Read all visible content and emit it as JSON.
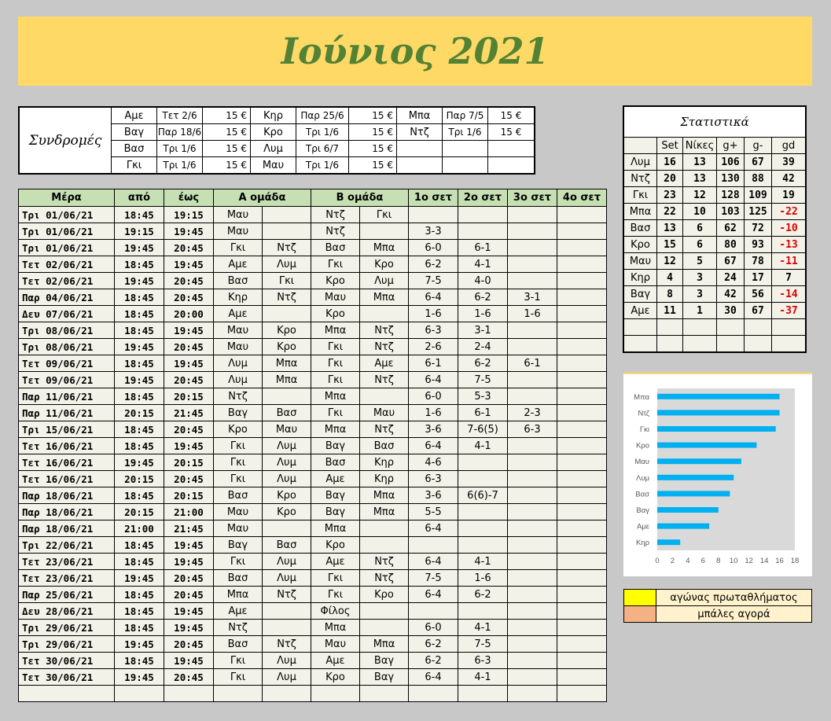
{
  "title": "Ιούνιος 2021",
  "subscriptions": {
    "label": "Συνδρομές",
    "rows": [
      [
        "Αμε",
        "Τετ 2/6",
        "15 €",
        "Κηρ",
        "Παρ 25/6",
        "15 €",
        "Μπα",
        "Παρ 7/5",
        "15 €"
      ],
      [
        "Βαγ",
        "Παρ 18/6",
        "15 €",
        "Κρο",
        "Τρι 1/6",
        "15 €",
        "Ντζ",
        "Τρι 1/6",
        "15 €"
      ],
      [
        "Βασ",
        "Τρι 1/6",
        "15 €",
        "Λυμ",
        "Τρι 6/7",
        "15 €",
        "",
        "",
        ""
      ],
      [
        "Γκι",
        "Τρι 1/6",
        "15 €",
        "Μαυ",
        "Τρι 1/6",
        "15 €",
        "",
        "",
        ""
      ]
    ]
  },
  "schedule": {
    "headers": [
      "Μέρα",
      "από",
      "έως",
      "Α ομάδα",
      "Β ομάδα",
      "1ο σετ",
      "2ο σετ",
      "3ο σετ",
      "4ο σετ"
    ],
    "rows": [
      [
        "Τρι  01/06/21",
        "18:45",
        "19:15",
        "Μαυ",
        "",
        "Ντζ",
        "Γκι",
        "",
        "",
        "",
        ""
      ],
      [
        "Τρι  01/06/21",
        "19:15",
        "19:45",
        "Μαυ",
        "",
        "Ντζ",
        "",
        "3-3",
        "",
        "",
        ""
      ],
      [
        "Τρι  01/06/21",
        "19:45",
        "20:45",
        "Γκι",
        "Ντζ",
        "Βασ",
        "Μπα",
        "6-0",
        "6-1",
        "",
        ""
      ],
      [
        "Τετ  02/06/21",
        "18:45",
        "19:45",
        "Αμε",
        "Λυμ",
        "Γκι",
        "Κρο",
        "6-2",
        "4-1",
        "",
        ""
      ],
      [
        "Τετ  02/06/21",
        "19:45",
        "20:45",
        "Βασ",
        "Γκι",
        "Κρο",
        "Λυμ",
        "7-5",
        "4-0",
        "",
        ""
      ],
      [
        "Παρ  04/06/21",
        "18:45",
        "20:45",
        "Κηρ",
        "Ντζ",
        "Μαυ",
        "Μπα",
        "6-4",
        "6-2",
        "3-1",
        ""
      ],
      [
        "Δευ  07/06/21",
        "18:45",
        "20:00",
        "Αμε",
        "",
        "Κρο",
        "",
        "1-6",
        "1-6",
        "1-6",
        ""
      ],
      [
        "Τρι  08/06/21",
        "18:45",
        "19:45",
        "Μαυ",
        "Κρο",
        "Μπα",
        "Ντζ",
        "6-3",
        "3-1",
        "",
        ""
      ],
      [
        "Τρι  08/06/21",
        "19:45",
        "20:45",
        "Μαυ",
        "Κρο",
        "Γκι",
        "Ντζ",
        "2-6",
        "2-4",
        "",
        ""
      ],
      [
        "Τετ  09/06/21",
        "18:45",
        "19:45",
        "Λυμ",
        "Μπα",
        "Γκι",
        "Αμε",
        "6-1",
        "6-2",
        "6-1",
        ""
      ],
      [
        "Τετ  09/06/21",
        "19:45",
        "20:45",
        "Λυμ",
        "Μπα",
        "Γκι",
        "Ντζ",
        "6-4",
        "7-5",
        "",
        ""
      ],
      [
        "Παρ  11/06/21",
        "18:45",
        "20:15",
        "Ντζ",
        "",
        "Μπα",
        "",
        "6-0",
        "5-3",
        "",
        ""
      ],
      [
        "Παρ  11/06/21",
        "20:15",
        "21:45",
        "Βαγ",
        "Βασ",
        "Γκι",
        "Μαυ",
        "1-6",
        "6-1",
        "2-3",
        ""
      ],
      [
        "Τρι  15/06/21",
        "18:45",
        "20:45",
        "Κρο",
        "Μαυ",
        "Μπα",
        "Ντζ",
        "3-6",
        "7-6(5)",
        "6-3",
        ""
      ],
      [
        "Τετ  16/06/21",
        "18:45",
        "19:45",
        "Γκι",
        "Λυμ",
        "Βαγ",
        "Βασ",
        "6-4",
        "4-1",
        "",
        ""
      ],
      [
        "Τετ  16/06/21",
        "19:45",
        "20:15",
        "Γκι",
        "Λυμ",
        "Βασ",
        "Κηρ",
        "4-6",
        "",
        "",
        ""
      ],
      [
        "Τετ  16/06/21",
        "20:15",
        "20:45",
        "Γκι",
        "Λυμ",
        "Αμε",
        "Κηρ",
        "6-3",
        "",
        "",
        ""
      ],
      [
        "Παρ  18/06/21",
        "18:45",
        "20:15",
        "Βασ",
        "Κρο",
        "Βαγ",
        "Μπα",
        "3-6",
        "6(6)-7",
        "",
        ""
      ],
      [
        "Παρ  18/06/21",
        "20:15",
        "21:00",
        "Μαυ",
        "Κρο",
        "Βαγ",
        "Μπα",
        "5-5",
        "",
        "",
        ""
      ],
      [
        "Παρ  18/06/21",
        "21:00",
        "21:45",
        "Μαυ",
        "",
        "Μπα",
        "",
        "6-4",
        "",
        "",
        ""
      ],
      [
        "Τρι  22/06/21",
        "18:45",
        "19:45",
        "Βαγ",
        "Βασ",
        "Κρο",
        "",
        "",
        "",
        "",
        ""
      ],
      [
        "Τετ  23/06/21",
        "18:45",
        "19:45",
        "Γκι",
        "Λυμ",
        "Αμε",
        "Ντζ",
        "6-4",
        "4-1",
        "",
        ""
      ],
      [
        "Τετ  23/06/21",
        "19:45",
        "20:45",
        "Βασ",
        "Λυμ",
        "Γκι",
        "Ντζ",
        "7-5",
        "1-6",
        "",
        ""
      ],
      [
        "Παρ  25/06/21",
        "18:45",
        "20:45",
        "Μπα",
        "Ντζ",
        "Γκι",
        "Κρο",
        "6-4",
        "6-2",
        "",
        ""
      ],
      [
        "Δευ  28/06/21",
        "18:45",
        "19:45",
        "Αμε",
        "",
        "Φίλος",
        "",
        "",
        "",
        "",
        ""
      ],
      [
        "Τρι  29/06/21",
        "18:45",
        "19:45",
        "Ντζ",
        "",
        "Μπα",
        "",
        "6-0",
        "4-1",
        "",
        ""
      ],
      [
        "Τρι  29/06/21",
        "19:45",
        "20:45",
        "Βασ",
        "Ντζ",
        "Μαυ",
        "Μπα",
        "6-2",
        "7-5",
        "",
        ""
      ],
      [
        "Τετ  30/06/21",
        "18:45",
        "19:45",
        "Γκι",
        "Λυμ",
        "Αμε",
        "Βαγ",
        "6-2",
        "6-3",
        "",
        ""
      ],
      [
        "Τετ  30/06/21",
        "19:45",
        "20:45",
        "Γκι",
        "Λυμ",
        "Κρο",
        "Βαγ",
        "6-4",
        "4-1",
        "",
        ""
      ],
      [
        "",
        "",
        "",
        "",
        "",
        "",
        "",
        "",
        "",
        "",
        ""
      ]
    ]
  },
  "stats": {
    "title": "Στατιστικά",
    "headers": [
      "",
      "Set",
      "Νίκες",
      "g+",
      "g-",
      "gd"
    ],
    "rows": [
      [
        "Λυμ",
        "16",
        "13",
        "106",
        "67",
        "39"
      ],
      [
        "Ντζ",
        "20",
        "13",
        "130",
        "88",
        "42"
      ],
      [
        "Γκι",
        "23",
        "12",
        "128",
        "109",
        "19"
      ],
      [
        "Μπα",
        "22",
        "10",
        "103",
        "125",
        "-22"
      ],
      [
        "Βασ",
        "13",
        "6",
        "62",
        "72",
        "-10"
      ],
      [
        "Κρο",
        "15",
        "6",
        "80",
        "93",
        "-13"
      ],
      [
        "Μαυ",
        "12",
        "5",
        "67",
        "78",
        "-11"
      ],
      [
        "Κηρ",
        "4",
        "3",
        "24",
        "17",
        "7"
      ],
      [
        "Βαγ",
        "8",
        "3",
        "42",
        "56",
        "-14"
      ],
      [
        "Αμε",
        "11",
        "1",
        "30",
        "67",
        "-37"
      ],
      [
        "",
        "",
        "",
        "",
        "",
        ""
      ],
      [
        "",
        "",
        "",
        "",
        "",
        ""
      ]
    ]
  },
  "chart_data": {
    "type": "bar",
    "orientation": "horizontal",
    "categories": [
      "Μπα",
      "Ντζ",
      "Γκι",
      "Κρο",
      "Μαυ",
      "Λυμ",
      "Βασ",
      "Βαγ",
      "Αμε",
      "Κηρ"
    ],
    "values": [
      16,
      16,
      15.5,
      13,
      11,
      10,
      9.5,
      8,
      6.8,
      3
    ],
    "xlim": [
      0,
      18
    ],
    "xticks": [
      "0",
      "2",
      "4",
      "6",
      "8",
      "10",
      "12",
      "14",
      "16",
      "18"
    ],
    "bar_color": "#00b0f0",
    "grid": false
  },
  "legend": {
    "items": [
      {
        "color": "#ffff00",
        "label": "αγώνας πρωταθλήματος"
      },
      {
        "color": "#f4b183",
        "label": "μπάλες αγορά"
      }
    ]
  }
}
